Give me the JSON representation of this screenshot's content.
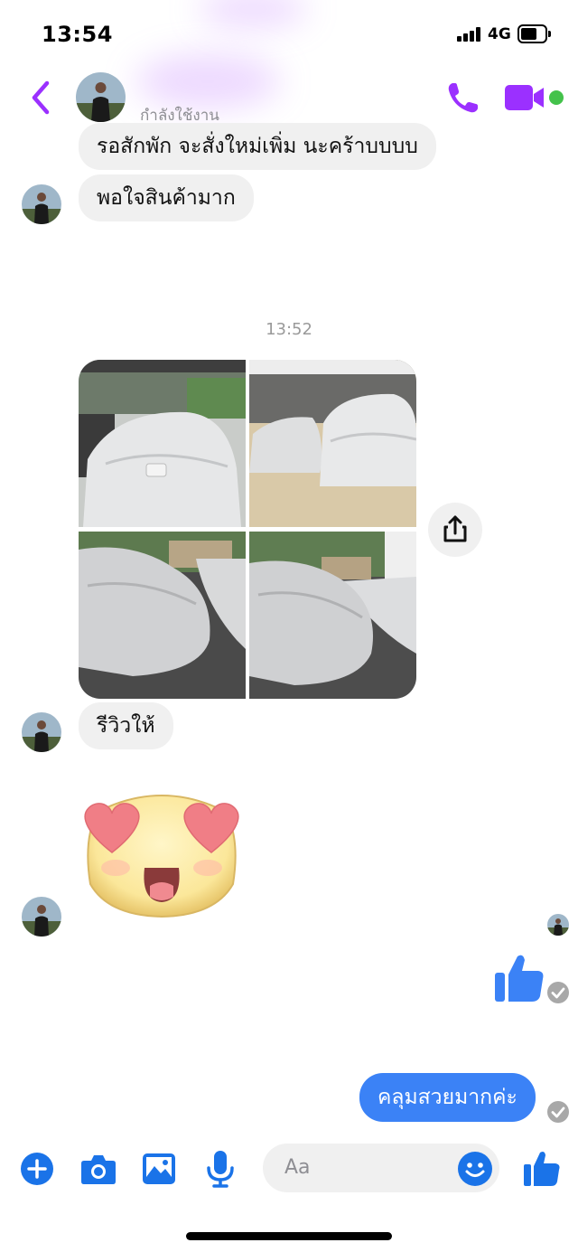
{
  "status_bar": {
    "time": "13:54",
    "network": "4G"
  },
  "header": {
    "status": "กำลังใช้งาน"
  },
  "messages": {
    "m1": "รอสักพัก จะสั่งใหม่เพิ่ม นะคร้าบบบบ",
    "m2": "พอใจสินค้ามาก",
    "timestamp": "13:52",
    "m3": "รีวิวให้",
    "m4": "คลุมสวยมากค่ะ"
  },
  "composer": {
    "placeholder": "Aa"
  },
  "colors": {
    "accent": "#9b30ff",
    "bubble_out": "#3b82f6",
    "icon_blue": "#1a73e8",
    "online": "#44c24b"
  }
}
